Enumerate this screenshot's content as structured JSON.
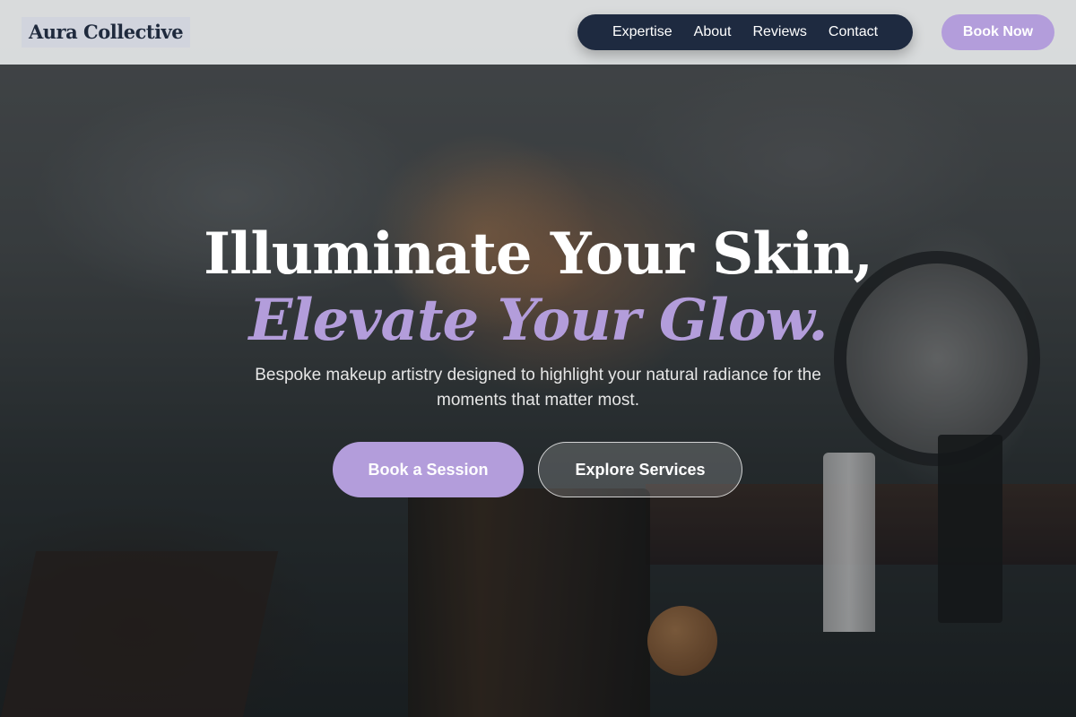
{
  "header": {
    "logo": "Aura Collective",
    "nav": [
      "Expertise",
      "About",
      "Reviews",
      "Contact"
    ],
    "cta": "Book Now"
  },
  "hero": {
    "title_line1": "Illuminate Your Skin,",
    "title_line2": "Elevate Your Glow.",
    "subtitle": "Bespoke makeup artistry designed to highlight your natural radiance for the moments that matter most.",
    "primary_button": "Book a Session",
    "secondary_button": "Explore Services"
  },
  "colors": {
    "accent": "#b39ddb",
    "nav_background": "#1e2a40",
    "header_background": "#e2e4e6"
  }
}
